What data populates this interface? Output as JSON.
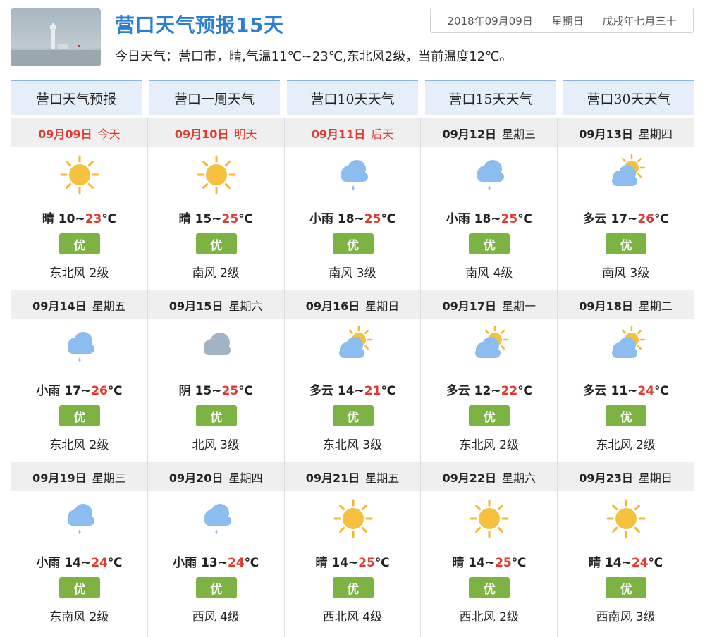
{
  "header": {
    "title": "营口天气预报15天",
    "summary": "今日天气：营口市，晴,气温11℃~23℃,东北风2级，当前温度12℃。",
    "date": "2018年09月09日",
    "weekday": "星期日",
    "lunar": "戊戌年七月三十"
  },
  "tabs": [
    "营口天气预报",
    "营口一周天气",
    "营口10天天气",
    "营口15天天气",
    "营口30天天气"
  ],
  "colors": {
    "accent": "#2a7fd4",
    "high_temp": "#e03a2f",
    "aqi_good": "#7cb342",
    "tab_bg": "#e5eef9"
  },
  "days": [
    {
      "date": "09月09日",
      "week": "今天",
      "highlight": true,
      "icon": "sun-icon",
      "cond": "晴",
      "low": "10",
      "high": "23",
      "aqi": "优",
      "wind": "东北风 2级"
    },
    {
      "date": "09月10日",
      "week": "明天",
      "highlight": true,
      "icon": "sun-icon",
      "cond": "晴",
      "low": "15",
      "high": "25",
      "aqi": "优",
      "wind": "南风 2级"
    },
    {
      "date": "09月11日",
      "week": "后天",
      "highlight": true,
      "icon": "light-rain-icon",
      "cond": "小雨",
      "low": "18",
      "high": "25",
      "aqi": "优",
      "wind": "南风 3级"
    },
    {
      "date": "09月12日",
      "week": "星期三",
      "highlight": false,
      "icon": "light-rain-icon",
      "cond": "小雨",
      "low": "18",
      "high": "25",
      "aqi": "优",
      "wind": "南风 4级"
    },
    {
      "date": "09月13日",
      "week": "星期四",
      "highlight": false,
      "icon": "partly-cloudy-icon",
      "cond": "多云",
      "low": "17",
      "high": "26",
      "aqi": "优",
      "wind": "南风 3级"
    },
    {
      "date": "09月14日",
      "week": "星期五",
      "highlight": false,
      "icon": "light-rain-icon",
      "cond": "小雨",
      "low": "17",
      "high": "26",
      "aqi": "优",
      "wind": "东北风 2级"
    },
    {
      "date": "09月15日",
      "week": "星期六",
      "highlight": false,
      "icon": "overcast-icon",
      "cond": "阴",
      "low": "15",
      "high": "25",
      "aqi": "优",
      "wind": "北风 3级"
    },
    {
      "date": "09月16日",
      "week": "星期日",
      "highlight": false,
      "icon": "partly-cloudy-icon",
      "cond": "多云",
      "low": "14",
      "high": "21",
      "aqi": "优",
      "wind": "东北风 3级"
    },
    {
      "date": "09月17日",
      "week": "星期一",
      "highlight": false,
      "icon": "partly-cloudy-icon",
      "cond": "多云",
      "low": "12",
      "high": "22",
      "aqi": "优",
      "wind": "东北风 2级"
    },
    {
      "date": "09月18日",
      "week": "星期二",
      "highlight": false,
      "icon": "partly-cloudy-icon",
      "cond": "多云",
      "low": "11",
      "high": "24",
      "aqi": "优",
      "wind": "东北风 2级"
    },
    {
      "date": "09月19日",
      "week": "星期三",
      "highlight": false,
      "icon": "light-rain-icon",
      "cond": "小雨",
      "low": "14",
      "high": "24",
      "aqi": "优",
      "wind": "东南风 2级"
    },
    {
      "date": "09月20日",
      "week": "星期四",
      "highlight": false,
      "icon": "light-rain-icon",
      "cond": "小雨",
      "low": "13",
      "high": "24",
      "aqi": "优",
      "wind": "西风 4级"
    },
    {
      "date": "09月21日",
      "week": "星期五",
      "highlight": false,
      "icon": "sun-icon",
      "cond": "晴",
      "low": "14",
      "high": "25",
      "aqi": "优",
      "wind": "西北风 4级"
    },
    {
      "date": "09月22日",
      "week": "星期六",
      "highlight": false,
      "icon": "sun-icon",
      "cond": "晴",
      "low": "14",
      "high": "25",
      "aqi": "优",
      "wind": "西北风 2级"
    },
    {
      "date": "09月23日",
      "week": "星期日",
      "highlight": false,
      "icon": "sun-icon",
      "cond": "晴",
      "low": "14",
      "high": "24",
      "aqi": "优",
      "wind": "西南风 3级"
    }
  ]
}
